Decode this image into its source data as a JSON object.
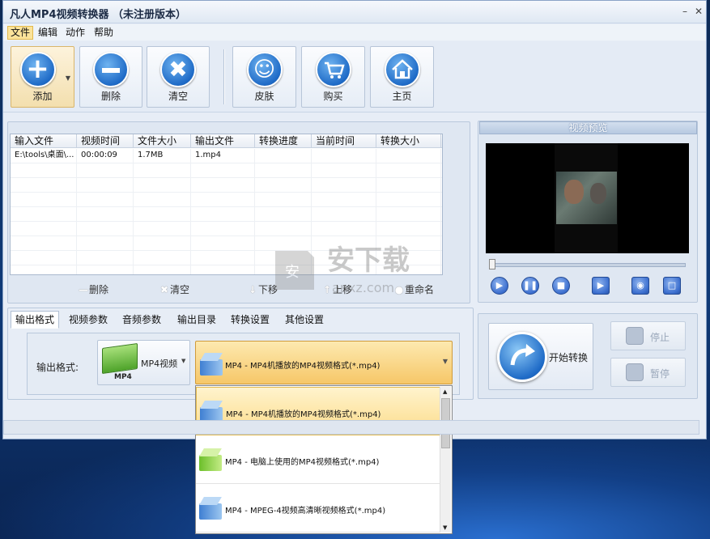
{
  "window": {
    "title": "凡人MP4视频转换器 （未注册版本）"
  },
  "menu": [
    "文件",
    "编辑",
    "动作",
    "帮助"
  ],
  "toolbar": {
    "add": "添加",
    "delete": "删除",
    "clear": "清空",
    "skin": "皮肤",
    "buy": "购买",
    "home": "主页"
  },
  "grid": {
    "columns": [
      "输入文件",
      "视频时间",
      "文件大小",
      "输出文件",
      "转换进度",
      "当前时间",
      "转换大小"
    ],
    "rows": [
      {
        "input": "E:\\tools\\桌面\\...",
        "duration": "00:00:09",
        "size": "1.7MB",
        "output": "1.mp4",
        "progress": "",
        "current": "",
        "converted": ""
      }
    ]
  },
  "list_actions": {
    "delete": "删除",
    "clear": "清空",
    "down": "下移",
    "up": "上移",
    "rename": "重命名"
  },
  "tabs": [
    "输出格式",
    "视频参数",
    "音频参数",
    "输出目录",
    "转换设置",
    "其他设置"
  ],
  "output": {
    "label": "输出格式:",
    "type_label": "MP4视频",
    "type_caption": "MP4",
    "selected": "MP4 - MP4机播放的MP4视频格式(*.mp4)",
    "options": [
      "MP4 - MP4机播放的MP4视频格式(*.mp4)",
      "MP4 - 电脑上使用的MP4视频格式(*.mp4)",
      "MP4 - MPEG-4视频高清晰视频格式(*.mp4)"
    ]
  },
  "preview": {
    "title": "视频预览"
  },
  "actions": {
    "start": "开始转换",
    "stop": "停止",
    "pause": "暂停"
  },
  "watermark": {
    "name": "安下载",
    "url": "anxz.com"
  },
  "colors": {
    "accent": "#f6c768",
    "window_bg": "#e7edf6",
    "desktop": "#0f3a78"
  },
  "icons": {
    "add": "plus-icon",
    "delete": "minus-icon",
    "clear": "x-icon",
    "skin": "smiley-icon",
    "buy": "cart-icon",
    "home": "house-icon"
  }
}
